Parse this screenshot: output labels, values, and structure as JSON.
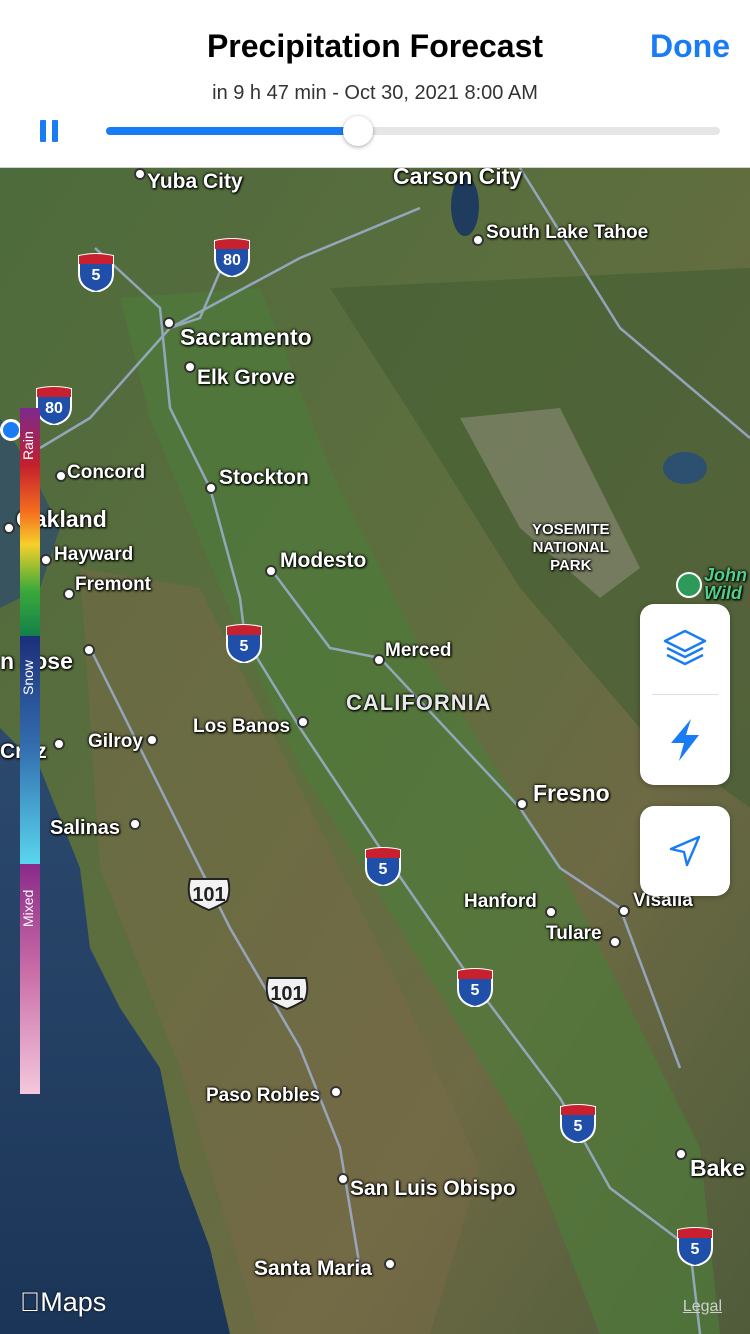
{
  "header": {
    "title": "Precipitation Forecast",
    "done_label": "Done",
    "subtitle": "in 9 h 47 min - Oct 30, 2021 8:00 AM",
    "timeline_progress": 0.41
  },
  "map": {
    "cities": [
      {
        "id": "yuba-city",
        "name": "Yuba City"
      },
      {
        "id": "carson-city",
        "name": "Carson City"
      },
      {
        "id": "south-lake-tahoe",
        "name": "South Lake Tahoe"
      },
      {
        "id": "sacramento",
        "name": "Sacramento"
      },
      {
        "id": "elk-grove",
        "name": "Elk Grove"
      },
      {
        "id": "concord",
        "name": "Concord"
      },
      {
        "id": "stockton",
        "name": "Stockton"
      },
      {
        "id": "oakland",
        "name": "Oakland"
      },
      {
        "id": "hayward",
        "name": "Hayward"
      },
      {
        "id": "fremont",
        "name": "Fremont"
      },
      {
        "id": "modesto",
        "name": "Modesto"
      },
      {
        "id": "san-jose",
        "name": "n Jose"
      },
      {
        "id": "merced",
        "name": "Merced"
      },
      {
        "id": "los-banos",
        "name": "Los Banos"
      },
      {
        "id": "gilroy",
        "name": "Gilroy"
      },
      {
        "id": "santa-cruz",
        "name": "Cruz"
      },
      {
        "id": "salinas",
        "name": "Salinas"
      },
      {
        "id": "fresno",
        "name": "Fresno"
      },
      {
        "id": "hanford",
        "name": "Hanford"
      },
      {
        "id": "visalia",
        "name": "Visalia"
      },
      {
        "id": "tulare",
        "name": "Tulare"
      },
      {
        "id": "paso-robles",
        "name": "Paso Robles"
      },
      {
        "id": "san-luis-obispo",
        "name": "San Luis Obispo"
      },
      {
        "id": "bakersfield",
        "name": "Bake"
      },
      {
        "id": "santa-maria",
        "name": "Santa Maria"
      },
      {
        "id": "john-muir",
        "name": "John\nWild"
      }
    ],
    "region_label": "CALIFORNIA",
    "park_label": "YOSEMITE\nNATIONAL\nPARK",
    "interstate_shields": [
      "5",
      "80",
      "80",
      "5",
      "5",
      "5",
      "5",
      "5"
    ],
    "us_shields": [
      "101",
      "101"
    ]
  },
  "legend": {
    "rain_label": "Rain",
    "snow_label": "Snow",
    "mixed_label": "Mixed"
  },
  "controls": {
    "layers_icon": "layers-icon",
    "lightning_icon": "lightning-icon",
    "location_icon": "location-arrow-icon"
  },
  "footer": {
    "maps_label": "Maps",
    "legal_label": "Legal"
  },
  "colors": {
    "accent": "#1a7cf5",
    "track": "#e6e6e6"
  }
}
